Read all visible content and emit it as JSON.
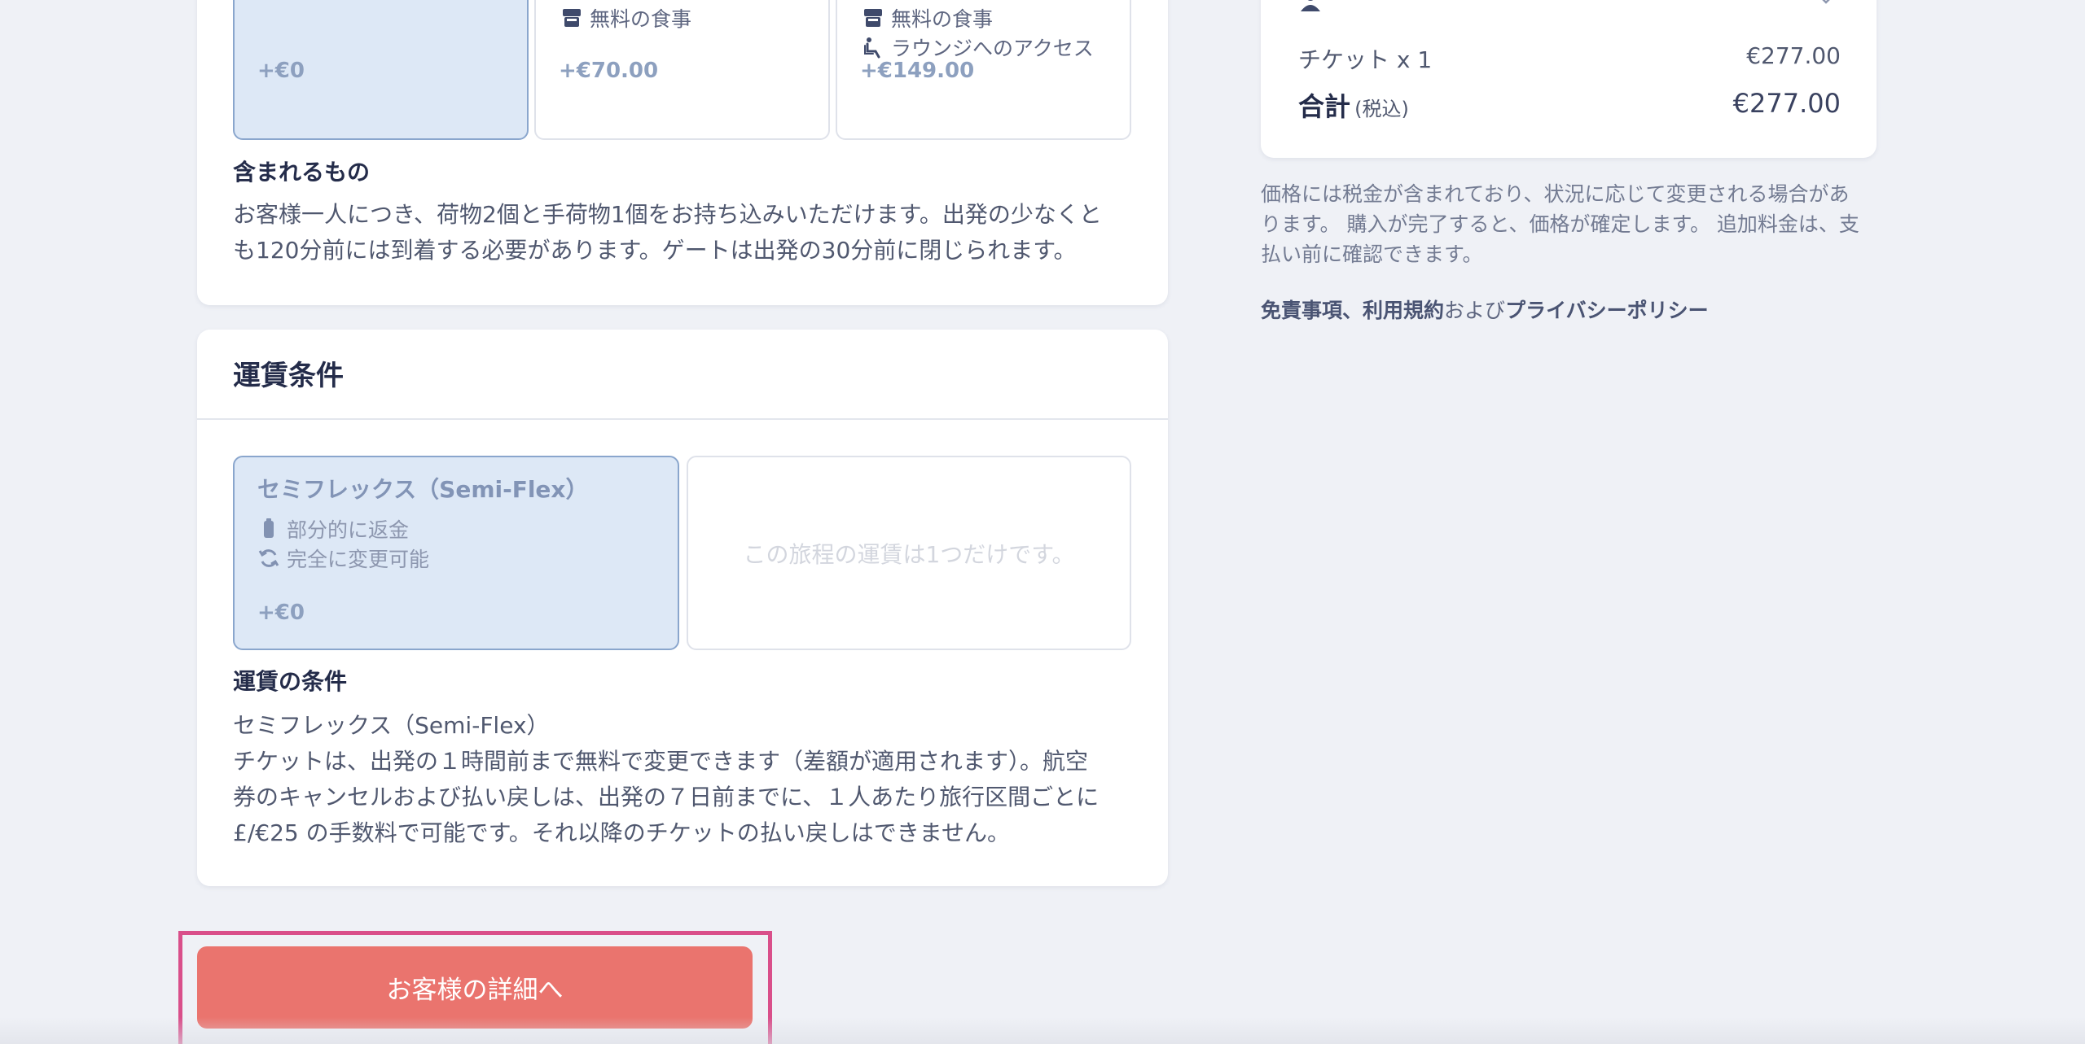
{
  "service_card": {
    "options": [
      {
        "price": "+€0",
        "features": []
      },
      {
        "price": "+€70.00",
        "features": [
          {
            "icon": "meal-icon",
            "label": "無料の食事"
          }
        ]
      },
      {
        "price": "+€149.00",
        "features": [
          {
            "icon": "meal-icon",
            "label": "無料の食事"
          },
          {
            "icon": "lounge-seat-icon",
            "label": "ラウンジへのアクセス"
          }
        ]
      }
    ],
    "included_heading": "含まれるもの",
    "included_lines": [
      "お客様一人につき、荷物2個と手荷物1個をお持ち込みいただけます。出発の少なくと",
      "も120分前には到着する必要があります。ゲートは出発の30分前に閉じられます。"
    ]
  },
  "fare_card": {
    "title": "運賃条件",
    "selected_option": {
      "name": "セミフレックス（Semi-Flex）",
      "features": [
        {
          "icon": "refund-icon",
          "label": "部分的に返金"
        },
        {
          "icon": "change-icon",
          "label": "完全に変更可能"
        }
      ],
      "price": "+€0"
    },
    "single_fare_note": "この旅程の運賃は1つだけです。",
    "conditions_heading": "運賃の条件",
    "conditions_lines": [
      "セミフレックス（Semi-Flex）",
      "チケットは、出発の１時間前まで無料で変更できます（差額が適用されます）。航空",
      "券のキャンセルおよび払い戻しは、出発の７日前までに、１人あたり旅行区間ごとに",
      "£/€25 の手数料で可能です。それ以降のチケットの払い戻しはできません。"
    ]
  },
  "summary": {
    "ticket_label": "チケット x 1",
    "ticket_price": "€277.00",
    "total_label": "合計",
    "total_tax_note": "(税込)",
    "total_price": "€277.00",
    "price_note_lines": [
      "価格には税金が含まれており、状況に応じて変更される場合があ",
      "ります。 購入が完了すると、価格が確定します。 追加料金は、支",
      "払い前に確認できます。"
    ],
    "legal": {
      "disclaimer": "免責事項",
      "separator": "、",
      "terms": "利用規約",
      "and": "および",
      "privacy": "プライバシーポリシー"
    }
  },
  "cta": {
    "label": "お客様の詳細へ"
  },
  "colors": {
    "accent_button": "#ea746e",
    "highlight_border": "#d94f8a",
    "selected_tile": "#dde8f6"
  }
}
